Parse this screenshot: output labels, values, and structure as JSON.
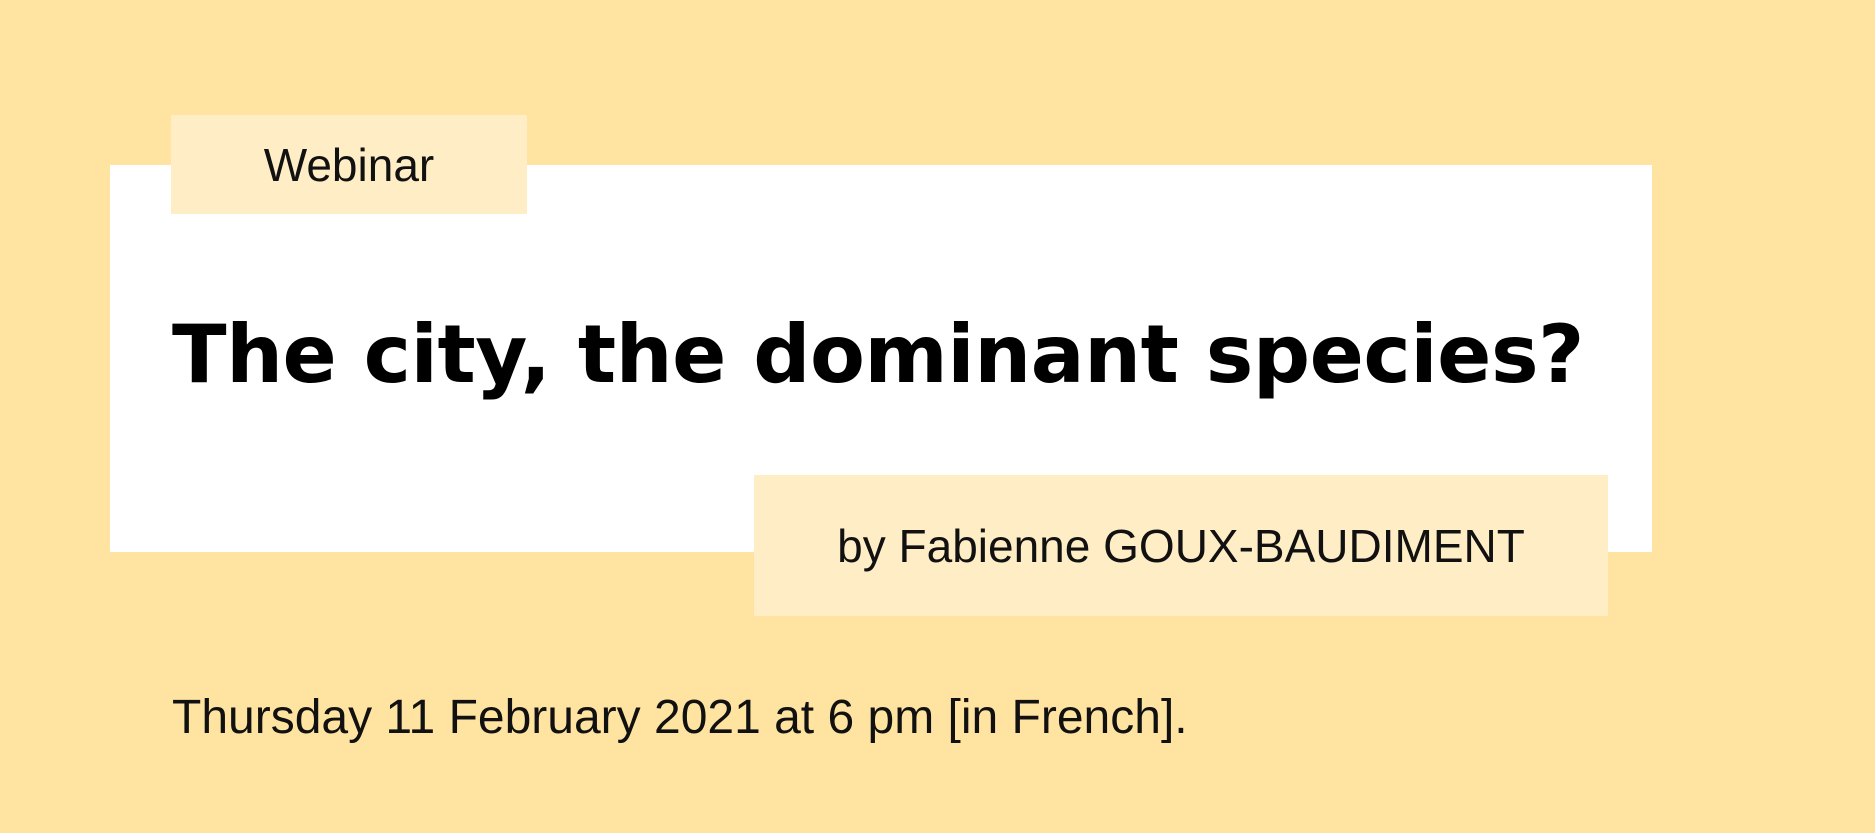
{
  "banner": {
    "tag_label": "Webinar",
    "title": "The city, the dominant species?",
    "author": "by Fabienne GOUX-BAUDIMENT",
    "date_line": "Thursday 11 February 2021 at 6 pm [in French]."
  },
  "colors": {
    "background": "#FFE3A0",
    "card": "#FFFFFF",
    "label_box": "#FFEDC6",
    "text": "#000000"
  }
}
